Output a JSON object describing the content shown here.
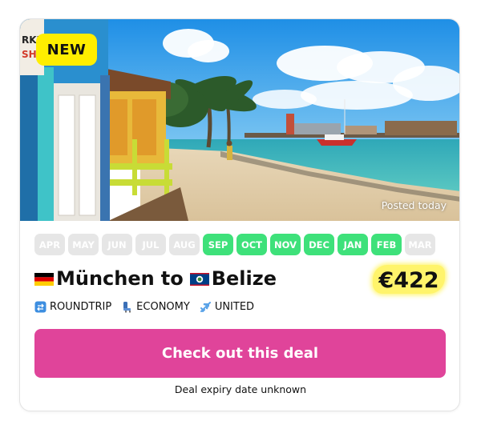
{
  "badge": {
    "label": "NEW"
  },
  "photo": {
    "posted": "Posted today"
  },
  "months": [
    {
      "label": "APR",
      "active": false
    },
    {
      "label": "MAY",
      "active": false
    },
    {
      "label": "JUN",
      "active": false
    },
    {
      "label": "JUL",
      "active": false
    },
    {
      "label": "AUG",
      "active": false
    },
    {
      "label": "SEP",
      "active": true
    },
    {
      "label": "OCT",
      "active": true
    },
    {
      "label": "NOV",
      "active": true
    },
    {
      "label": "DEC",
      "active": true
    },
    {
      "label": "JAN",
      "active": true
    },
    {
      "label": "FEB",
      "active": true
    },
    {
      "label": "MAR",
      "active": false
    }
  ],
  "route": {
    "origin": "München",
    "origin_flag": "germany-flag-icon",
    "connector": "to",
    "destination": "Belize",
    "destination_flag": "belize-flag-icon"
  },
  "price": "€422",
  "meta": {
    "trip_type": "ROUNDTRIP",
    "trip_type_icon": "repeat-icon",
    "cabin": "ECONOMY",
    "cabin_icon": "seat-icon",
    "airline": "UNITED",
    "airline_icon": "airplane-icon"
  },
  "cta": {
    "label": "Check out this deal"
  },
  "expiry": "Deal expiry date unknown",
  "colors": {
    "accent": "#e0449a",
    "month_active": "#3ee17a",
    "month_inactive": "#e6e6e6",
    "badge": "#ffee00",
    "price_highlight": "#fff46b"
  }
}
